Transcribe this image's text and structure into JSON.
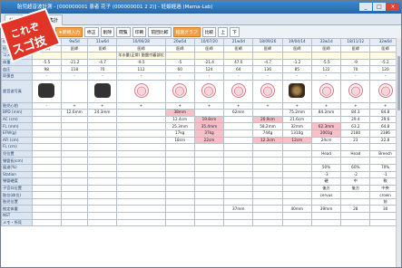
{
  "window": {
    "title": "胎児超音波計測 - [000000001 患者 花子 (000000001 2 2)] - 妊娠経過 (Mama-Lab)",
    "buttons": [
      "_",
      "□",
      "×"
    ]
  },
  "tabs": [
    "計測",
    "記録",
    "集計"
  ],
  "toolbar": {
    "items": [
      "計測 印刷",
      "過去 検診",
      "★新規入力",
      "修正",
      "削除",
      "閲覧",
      "印刷",
      "前回比較",
      "経過グラフ",
      "比較",
      "上",
      "下"
    ]
  },
  "banner": {
    "line1": "これぞ",
    "line2": "スゴ技"
  },
  "grid": {
    "headers": [
      "09/08/1",
      "9w5d",
      "11w6d",
      "10/06/28",
      "10/06/28",
      "20w5d",
      "10/07/20",
      "21w0d",
      "18/09/26",
      "19/04/14",
      "33w1d",
      "18/11/12",
      "32w6d"
    ],
    "rows": [
      {
        "label": "検診日",
        "cells": [
          "09/08/1",
          "9w5d",
          "11w6d",
          "10/06/28",
          "20w5d",
          "10/07/20",
          "21w0d",
          "18/09/26",
          "19/04/14",
          "33w1d",
          "18/11/12",
          "32w6d"
        ]
      },
      {
        "label": "担当医",
        "cells": [
          "医師",
          "医師",
          "医師",
          "医師",
          "医師",
          "医師",
          "医師",
          "医師",
          "医師",
          "医師",
          "医師",
          "医師"
        ]
      },
      {
        "label": "コメント",
        "cells": [
          "",
          "",
          "",
          "羊水量(正常) 胎盤付着部位",
          "",
          "",
          "",
          "",
          "",
          "",
          "",
          ""
        ]
      },
      {
        "label": "体重",
        "cells": [
          "-5.5",
          "-21.2",
          "-4.7",
          "-9.5",
          "-5",
          "-21.4",
          "47.0",
          "-4.7",
          "-1.2",
          "-5.5",
          "-9",
          "-5.2"
        ]
      },
      {
        "label": "血圧",
        "cells": [
          "98",
          "118",
          "70",
          "112",
          "60",
          "124",
          "64",
          "136",
          "85",
          "122",
          "70",
          "120"
        ]
      },
      {
        "label": "尿蛋白",
        "cells": [
          "-",
          "-",
          "-",
          "-",
          "-",
          "-",
          "-",
          "-",
          "-",
          "-",
          "-",
          "-"
        ]
      },
      {
        "label": "超音波写真",
        "cells": [
          "",
          "",
          "",
          "",
          "",
          "",
          "",
          "",
          "",
          "",
          "",
          ""
        ]
      },
      {
        "label": "胎児心拍",
        "cells": [
          "-",
          "+",
          "+",
          "+",
          "+",
          "+",
          "+",
          "+",
          "+",
          "+",
          "+",
          "+"
        ]
      },
      {
        "label": "BPD (mm)",
        "cells": [
          "",
          "12.6mm",
          "24.3mm",
          "",
          "38mm",
          "",
          "62mm",
          "",
          "75.2mm",
          "84.2mm",
          "84.3",
          "84.8"
        ]
      },
      {
        "label": "AC (cm)",
        "cells": [
          "",
          "",
          "",
          "",
          "12.4cm",
          "19.8cm",
          "",
          "20.9cm",
          "21.6cm",
          "",
          "29.4",
          "29.6"
        ]
      },
      {
        "label": "FL (mm)",
        "cells": [
          "",
          "",
          "",
          "",
          "25.3mm",
          "35.4mm",
          "",
          "58.2mm",
          "32mm",
          "62.3mm",
          "63.2",
          "64.8"
        ]
      },
      {
        "label": "EFW(g)",
        "cells": [
          "",
          "",
          "",
          "",
          "17kg",
          "37kg",
          "",
          "744g",
          "1310g",
          "2001g",
          "2180",
          "2386"
        ]
      },
      {
        "label": "AFI (cm)",
        "cells": [
          "",
          "",
          "",
          "",
          "18cm",
          "22cm",
          "",
          "12.3cm",
          "12cm",
          "24cm",
          "23",
          "22.8"
        ]
      },
      {
        "label": "FL (cm)",
        "cells": [
          "",
          "",
          "",
          "",
          "",
          "",
          "",
          "",
          "",
          "",
          "",
          ""
        ]
      },
      {
        "label": "児位置",
        "cells": [
          "",
          "",
          "",
          "",
          "",
          "",
          "",
          "",
          "",
          "Head",
          "Head",
          "Breech"
        ]
      },
      {
        "label": "頸管長(cm)",
        "cells": [
          "",
          "",
          "",
          "",
          "",
          "",
          "",
          "",
          "",
          "",
          "",
          ""
        ]
      },
      {
        "label": "展退(%)",
        "cells": [
          "",
          "",
          "",
          "",
          "",
          "",
          "",
          "",
          "",
          "50%",
          "60%",
          "70%"
        ]
      },
      {
        "label": "Station",
        "cells": [
          "",
          "",
          "",
          "",
          "",
          "",
          "",
          "",
          "",
          "-3",
          "-2",
          "-1"
        ]
      },
      {
        "label": "頸管硬度",
        "cells": [
          "",
          "",
          "",
          "",
          "",
          "",
          "",
          "",
          "",
          "硬",
          "中",
          "軟"
        ]
      },
      {
        "label": "子宮口位置",
        "cells": [
          "",
          "",
          "",
          "",
          "",
          "",
          "",
          "",
          "",
          "後方",
          "後方",
          "中央"
        ]
      },
      {
        "label": "胎位(体位)",
        "cells": [
          "",
          "",
          "",
          "",
          "",
          "",
          "",
          "",
          "",
          "cervus",
          "",
          "crown"
        ]
      },
      {
        "label": "胎児位置",
        "cells": [
          "",
          "",
          "",
          "",
          "",
          "",
          "",
          "",
          "",
          "",
          "",
          "前"
        ]
      },
      {
        "label": "推定体重",
        "cells": [
          "",
          "",
          "",
          "",
          "",
          "",
          "37mm",
          "",
          "40mm",
          "39mm",
          "28",
          "30"
        ]
      },
      {
        "label": "NST",
        "cells": [
          "",
          "",
          "",
          "",
          "",
          "",
          "",
          "",
          "",
          "",
          "",
          ""
        ]
      },
      {
        "label": "メモ・所見",
        "cells": [
          "",
          "",
          "",
          "",
          "",
          "",
          "",
          "",
          "",
          "",
          "",
          ""
        ]
      }
    ]
  }
}
